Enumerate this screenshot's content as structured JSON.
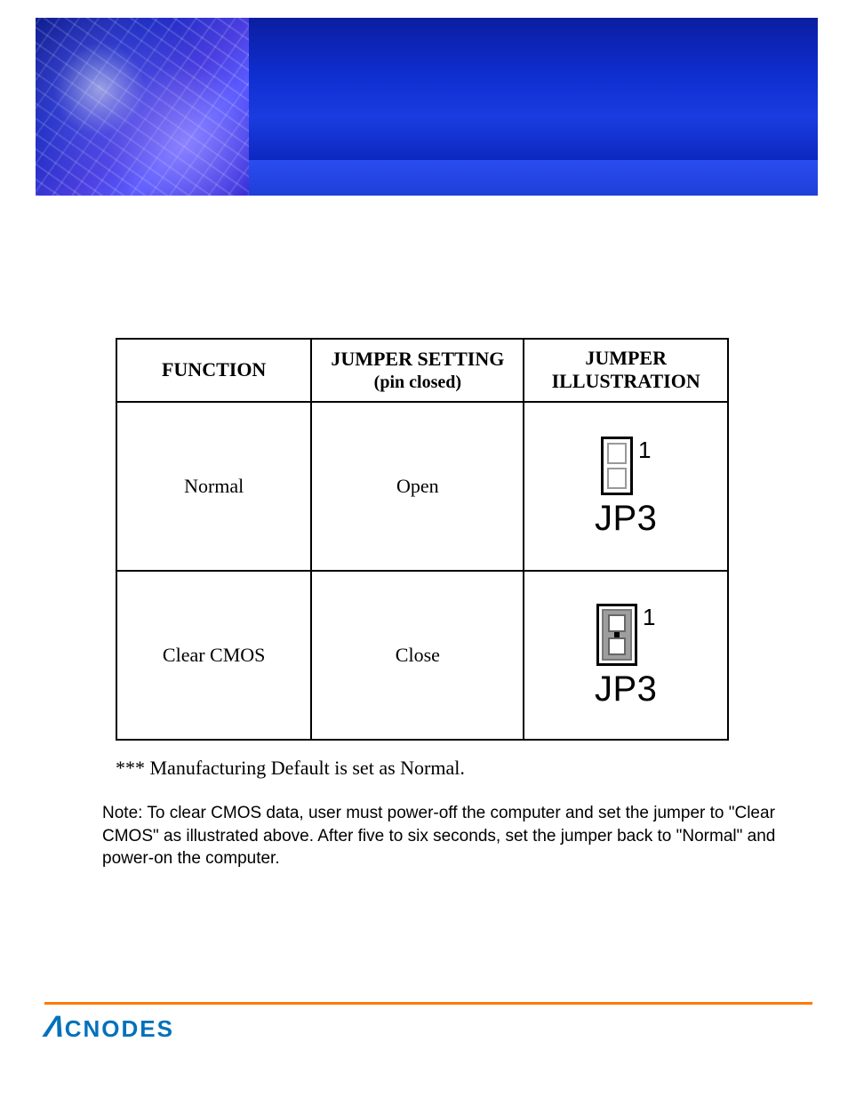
{
  "table": {
    "headers": {
      "function": "FUNCTION",
      "setting": "JUMPER SETTING",
      "setting_sub": "(pin closed)",
      "illustration": "JUMPER ILLUSTRATION"
    },
    "rows": [
      {
        "function": "Normal",
        "setting": "Open",
        "jumper_label": "JP3",
        "pin_number": "1",
        "state": "open"
      },
      {
        "function": "Clear CMOS",
        "setting": "Close",
        "jumper_label": "JP3",
        "pin_number": "1",
        "state": "close"
      }
    ]
  },
  "default_note": "*** Manufacturing Default is set as Normal.",
  "procedure_note": "Note: To clear CMOS data, user must power-off the computer and set the jumper to \"Clear CMOS\" as illustrated above.   After five to six seconds, set the jumper back to \"Normal\" and power-on the computer.",
  "footer": {
    "brand_mark": "Λ",
    "brand_text": "CNODES"
  }
}
